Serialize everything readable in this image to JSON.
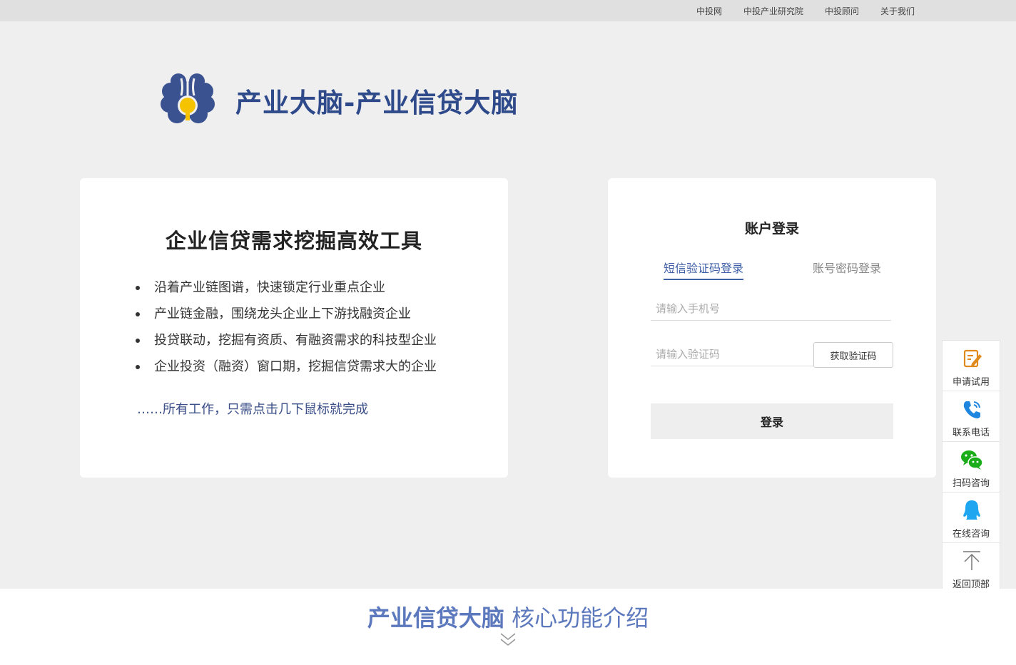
{
  "topnav": {
    "items": [
      "中投网",
      "中投产业研究院",
      "中投顾问",
      "关于我们"
    ]
  },
  "brand": {
    "title": "产业大脑-产业信贷大脑",
    "logo_icon": "brain-icon",
    "colors": {
      "primary": "#2f4a8a",
      "accent": "#f5c300"
    }
  },
  "intro": {
    "heading": "企业信贷需求挖掘高效工具",
    "features": [
      "沿着产业链图谱，快速锁定行业重点企业",
      "产业链金融，围绕龙头企业上下游找融资企业",
      "投贷联动，挖掘有资质、有融资需求的科技型企业",
      "企业投资（融资）窗口期，挖掘信贷需求大的企业"
    ],
    "tagline": "……所有工作，只需点击几下鼠标就完成"
  },
  "login": {
    "title": "账户登录",
    "tabs": [
      "短信验证码登录",
      "账号密码登录"
    ],
    "active_tab": "短信验证码登录",
    "phone_placeholder": "请输入手机号",
    "code_placeholder": "请输入验证码",
    "get_code_label": "获取验证码",
    "submit_label": "登录"
  },
  "sidebar": {
    "items": [
      {
        "label": "申请试用",
        "icon": "edit-icon"
      },
      {
        "label": "联系电话",
        "icon": "phone-icon"
      },
      {
        "label": "扫码咨询",
        "icon": "wechat-icon"
      },
      {
        "label": "在线咨询",
        "icon": "qq-icon"
      },
      {
        "label": "返回顶部",
        "icon": "back-to-top-icon"
      }
    ]
  },
  "section": {
    "title_strong": "产业信贷大脑",
    "title_light": " 核心功能介绍",
    "icon": "double-chevron-down-icon"
  }
}
